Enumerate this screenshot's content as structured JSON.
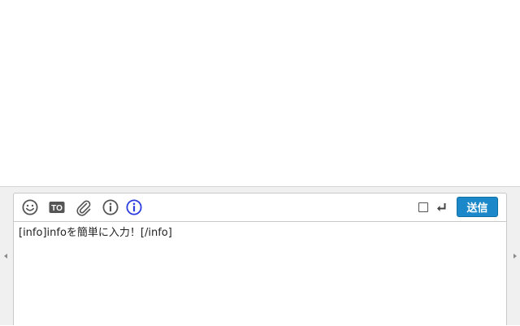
{
  "composer": {
    "send_label": "送信",
    "message_text": "[info]infoを簡単に入力！[/info]",
    "enter_to_send_checked": false
  },
  "toolbar": {
    "icons": [
      "emoji-icon",
      "to-icon",
      "attach-icon",
      "info-icon",
      "info-tag-icon",
      "return-icon"
    ],
    "to_icon_text": "TO",
    "accent_color": "#1a88c9",
    "info_tag_color": "#2b3de0",
    "icon_color": "#555555"
  }
}
